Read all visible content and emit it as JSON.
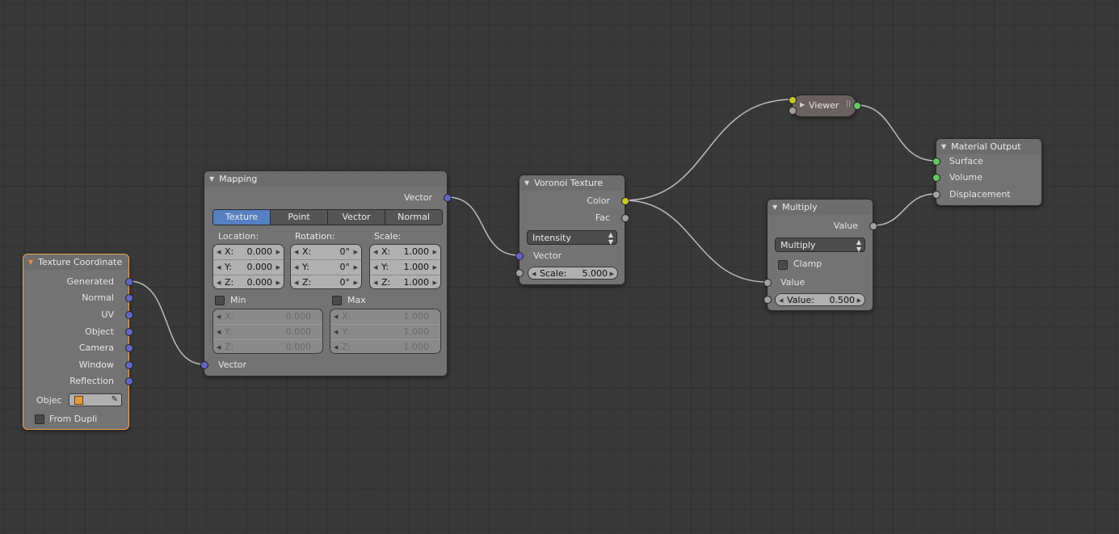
{
  "nodes": {
    "texture_coordinate": {
      "title": "Texture Coordinate",
      "outputs": [
        "Generated",
        "Normal",
        "UV",
        "Object",
        "Camera",
        "Window",
        "Reflection"
      ],
      "object_label": "Objec",
      "from_dupli_label": "From Dupli"
    },
    "mapping": {
      "title": "Mapping",
      "output_vector": "Vector",
      "tabs": [
        "Texture",
        "Point",
        "Vector",
        "Normal"
      ],
      "selected_tab": "Texture",
      "location_label": "Location:",
      "rotation_label": "Rotation:",
      "scale_label": "Scale:",
      "axes": [
        "X:",
        "Y:",
        "Z:"
      ],
      "location": [
        "0.000",
        "0.000",
        "0.000"
      ],
      "rotation": [
        "0°",
        "0°",
        "0°"
      ],
      "scale": [
        "1.000",
        "1.000",
        "1.000"
      ],
      "min_label": "Min",
      "max_label": "Max",
      "min": [
        "0.000",
        "0.000",
        "0.000"
      ],
      "max": [
        "1.000",
        "1.000",
        "1.000"
      ],
      "input_vector": "Vector"
    },
    "voronoi": {
      "title": "Voronoi Texture",
      "out_color": "Color",
      "out_fac": "Fac",
      "coloring": "Intensity",
      "in_vector": "Vector",
      "scale_label": "Scale:",
      "scale_value": "5.000"
    },
    "viewer": {
      "title": "Viewer"
    },
    "multiply": {
      "title": "Multiply",
      "out_value": "Value",
      "operation": "Multiply",
      "clamp_label": "Clamp",
      "in_value": "Value",
      "value_label": "Value:",
      "value": "0.500"
    },
    "material_output": {
      "title": "Material Output",
      "inputs": [
        "Surface",
        "Volume",
        "Displacement"
      ]
    }
  },
  "colors": {
    "vector_socket": "#6464c8",
    "color_socket": "#c7c729",
    "value_socket": "#a1a1a1",
    "shader_socket": "#63c763",
    "selected_tab": "#5680c2",
    "active_node_border": "#f0a34a"
  }
}
